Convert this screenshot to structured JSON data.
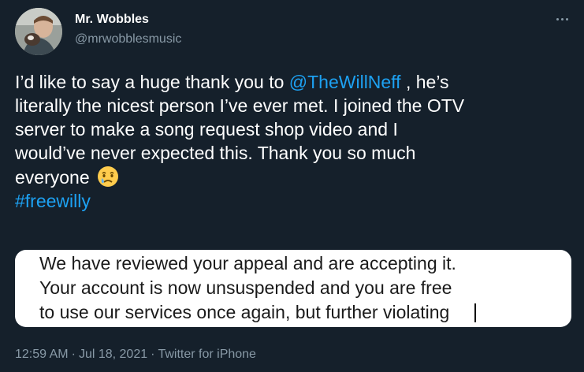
{
  "author": {
    "display_name": "Mr. Wobbles",
    "handle": "@mrwobblesmusic"
  },
  "tweet": {
    "line1_pre": "I’d like to say a huge thank you to ",
    "mention": "@TheWillNeff",
    "line1_post": " , he’s",
    "line2": "literally the nicest person I’ve ever met. I joined the OTV",
    "line3": "server to make a song request shop video and I",
    "line4": "would’ve never expected this. Thank you so much",
    "line5": "everyone",
    "emoji": "crying-face",
    "hashtag": "#freewilly"
  },
  "media": {
    "lines": [
      "We have reviewed your appeal and are accepting it.",
      "Your account is now unsuspended and you are free",
      "to use our services once again, but further violating"
    ]
  },
  "meta": {
    "time": "12:59 AM",
    "date": "Jul 18, 2021",
    "separator": "·",
    "source": "Twitter for iPhone"
  },
  "colors": {
    "background": "#15202b",
    "link": "#1da1f2",
    "secondary_text": "#8899a6",
    "primary_text": "#ffffff"
  }
}
